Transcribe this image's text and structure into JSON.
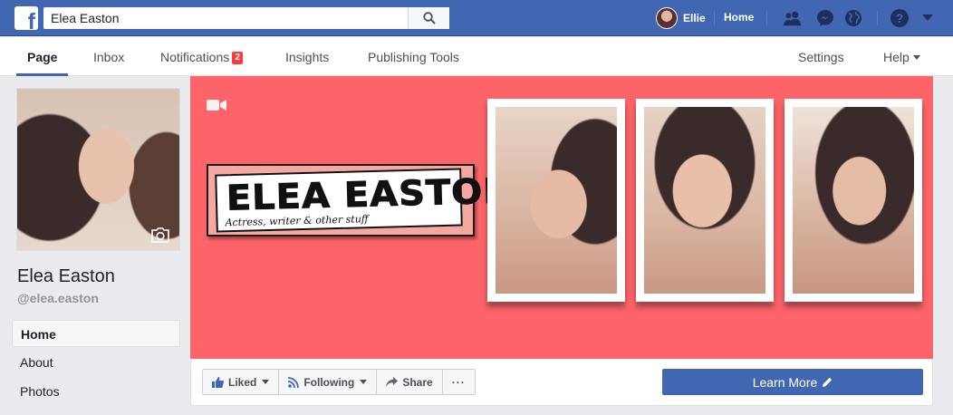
{
  "topbar": {
    "search_value": "Elea Easton",
    "user_name": "Ellie",
    "home_label": "Home",
    "colors": {
      "bar": "#4267b2"
    }
  },
  "pagenav": {
    "tabs": [
      {
        "label": "Page"
      },
      {
        "label": "Inbox"
      },
      {
        "label": "Notifications",
        "badge": "2"
      },
      {
        "label": "Insights"
      },
      {
        "label": "Publishing Tools"
      }
    ],
    "settings_label": "Settings",
    "help_label": "Help"
  },
  "sidebar": {
    "page_name": "Elea Easton",
    "handle": "@elea.easton",
    "items": [
      {
        "label": "Home"
      },
      {
        "label": "About"
      },
      {
        "label": "Photos"
      }
    ]
  },
  "cover": {
    "logo_title": "ELEA EASTON",
    "logo_tagline": "Actress, writer & other stuff",
    "background": "#fc6469"
  },
  "actions": {
    "liked_label": "Liked",
    "following_label": "Following",
    "share_label": "Share",
    "more_label": "···",
    "cta_label": "Learn More"
  }
}
